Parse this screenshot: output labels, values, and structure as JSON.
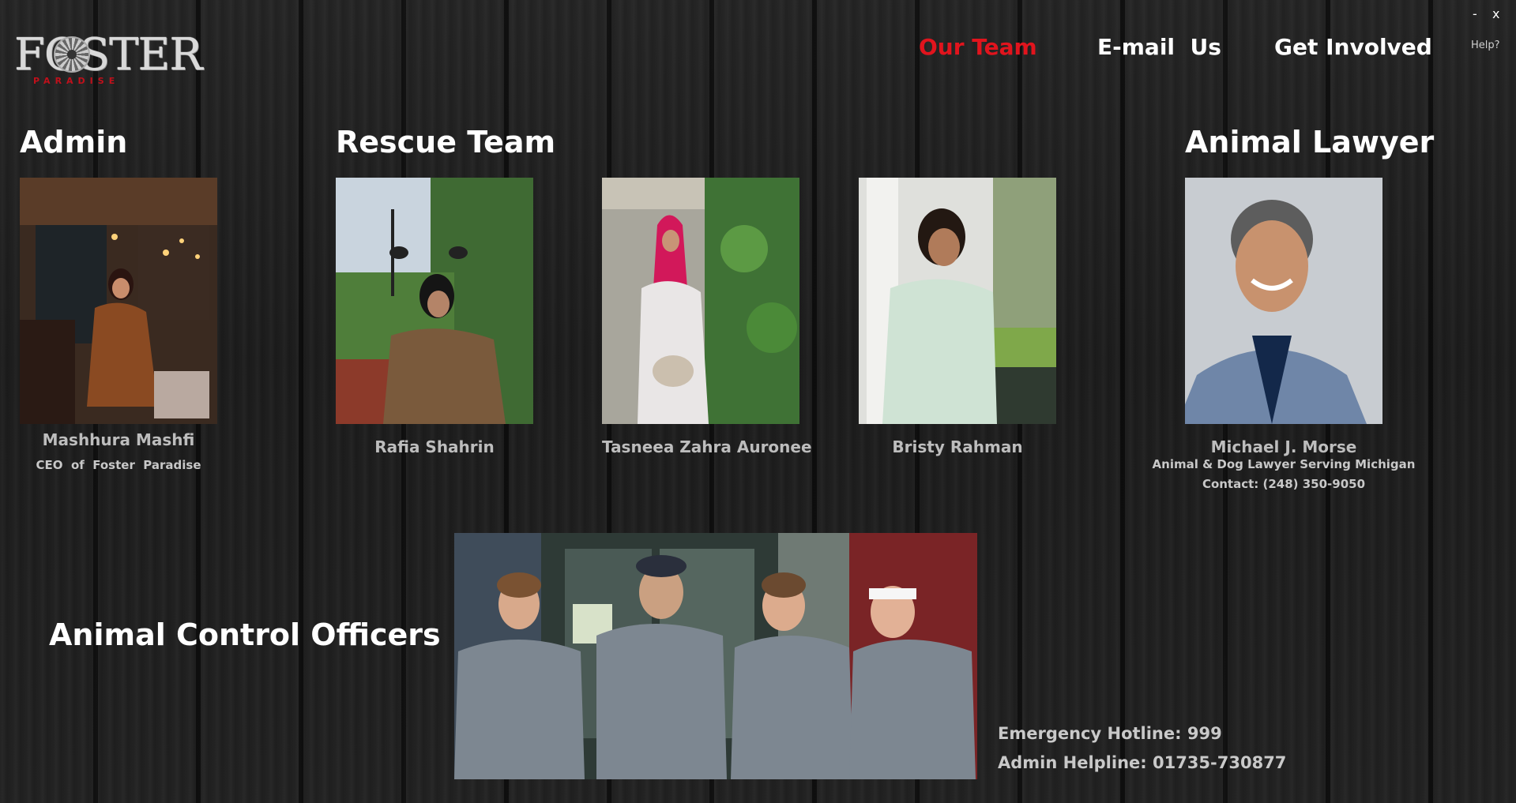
{
  "brand": {
    "name": "FOSTER",
    "tagline": "PARADISE"
  },
  "nav": {
    "items": [
      {
        "label": "Our Team",
        "active": true
      },
      {
        "label": "E-mail  Us",
        "active": false
      },
      {
        "label": "Get Involved",
        "active": false
      }
    ],
    "help": "Help?",
    "minimize": "-",
    "close": "x"
  },
  "sections": {
    "admin": "Admin",
    "rescue": "Rescue Team",
    "lawyer": "Animal Lawyer",
    "officers": "Animal Control Officers"
  },
  "admin": {
    "name": "Mashhura Mashfi",
    "role": "CEO  of  Foster  Paradise"
  },
  "rescue_team": [
    {
      "name": "Rafia Shahrin"
    },
    {
      "name": "Tasneea Zahra Auronee"
    },
    {
      "name": "Bristy Rahman"
    }
  ],
  "lawyer": {
    "name": "Michael J. Morse",
    "title": "Animal & Dog Lawyer Serving Michigan",
    "contact": "Contact: (248) 350-9050"
  },
  "hotlines": {
    "emergency": "Emergency Hotline: 999",
    "admin": "Admin Helpline: 01735-730877"
  },
  "colors": {
    "accent": "#e1141d",
    "text": "#ffffff",
    "muted": "#bdbdbd"
  }
}
